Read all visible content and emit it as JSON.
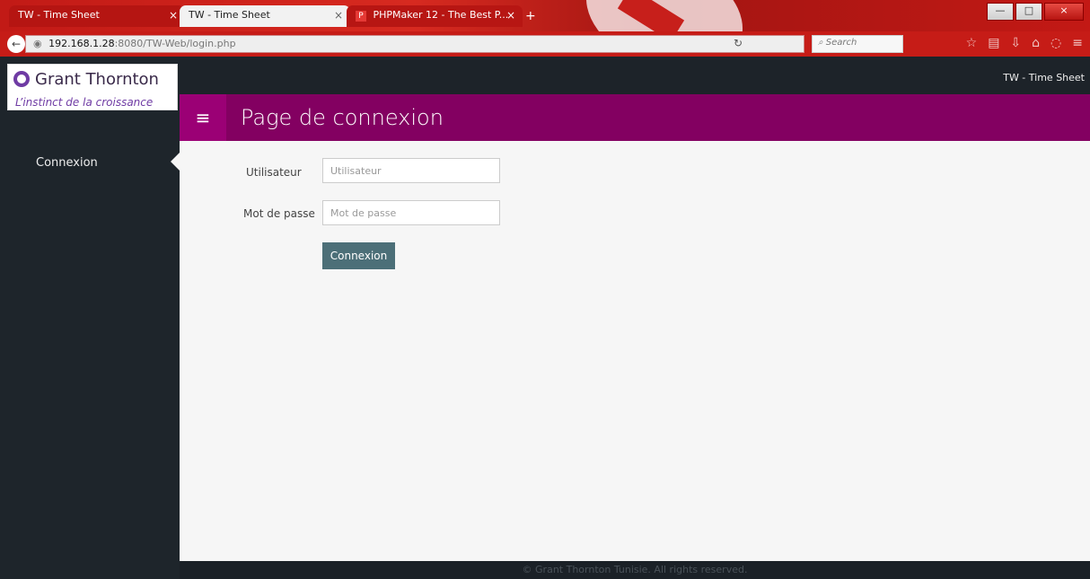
{
  "browser": {
    "tabs": [
      {
        "title": "TW - Time Sheet",
        "active": false
      },
      {
        "title": "TW - Time Sheet",
        "active": true
      },
      {
        "title": "PHPMaker 12 - The Best P...",
        "active": false
      }
    ],
    "new_tab_label": "+",
    "url": {
      "host": "192.168.1.28",
      "rest": ":8080/TW-Web/login.php"
    },
    "search_placeholder": "Search"
  },
  "app": {
    "brand_name": "Grant Thornton",
    "brand_tagline": "L’instinct de la croissance",
    "app_title": "TW - Time Sheet",
    "sidebar_item": "Connexion",
    "page_title": "Page de connexion"
  },
  "form": {
    "user_label": "Utilisateur",
    "user_placeholder": "Utilisateur",
    "password_label": "Mot de passe",
    "password_placeholder": "Mot de passe",
    "submit_label": "Connexion"
  },
  "footer_text": "© Grant Thornton Tunisie. All rights reserved.",
  "icons": {
    "menu": "hamburger-icon",
    "back": "back-arrow-icon",
    "search": "search-icon",
    "bookmark": "star-icon"
  },
  "colors": {
    "primary": "#830061",
    "button": "#4c6f78",
    "sidebar": "#1e252b"
  }
}
